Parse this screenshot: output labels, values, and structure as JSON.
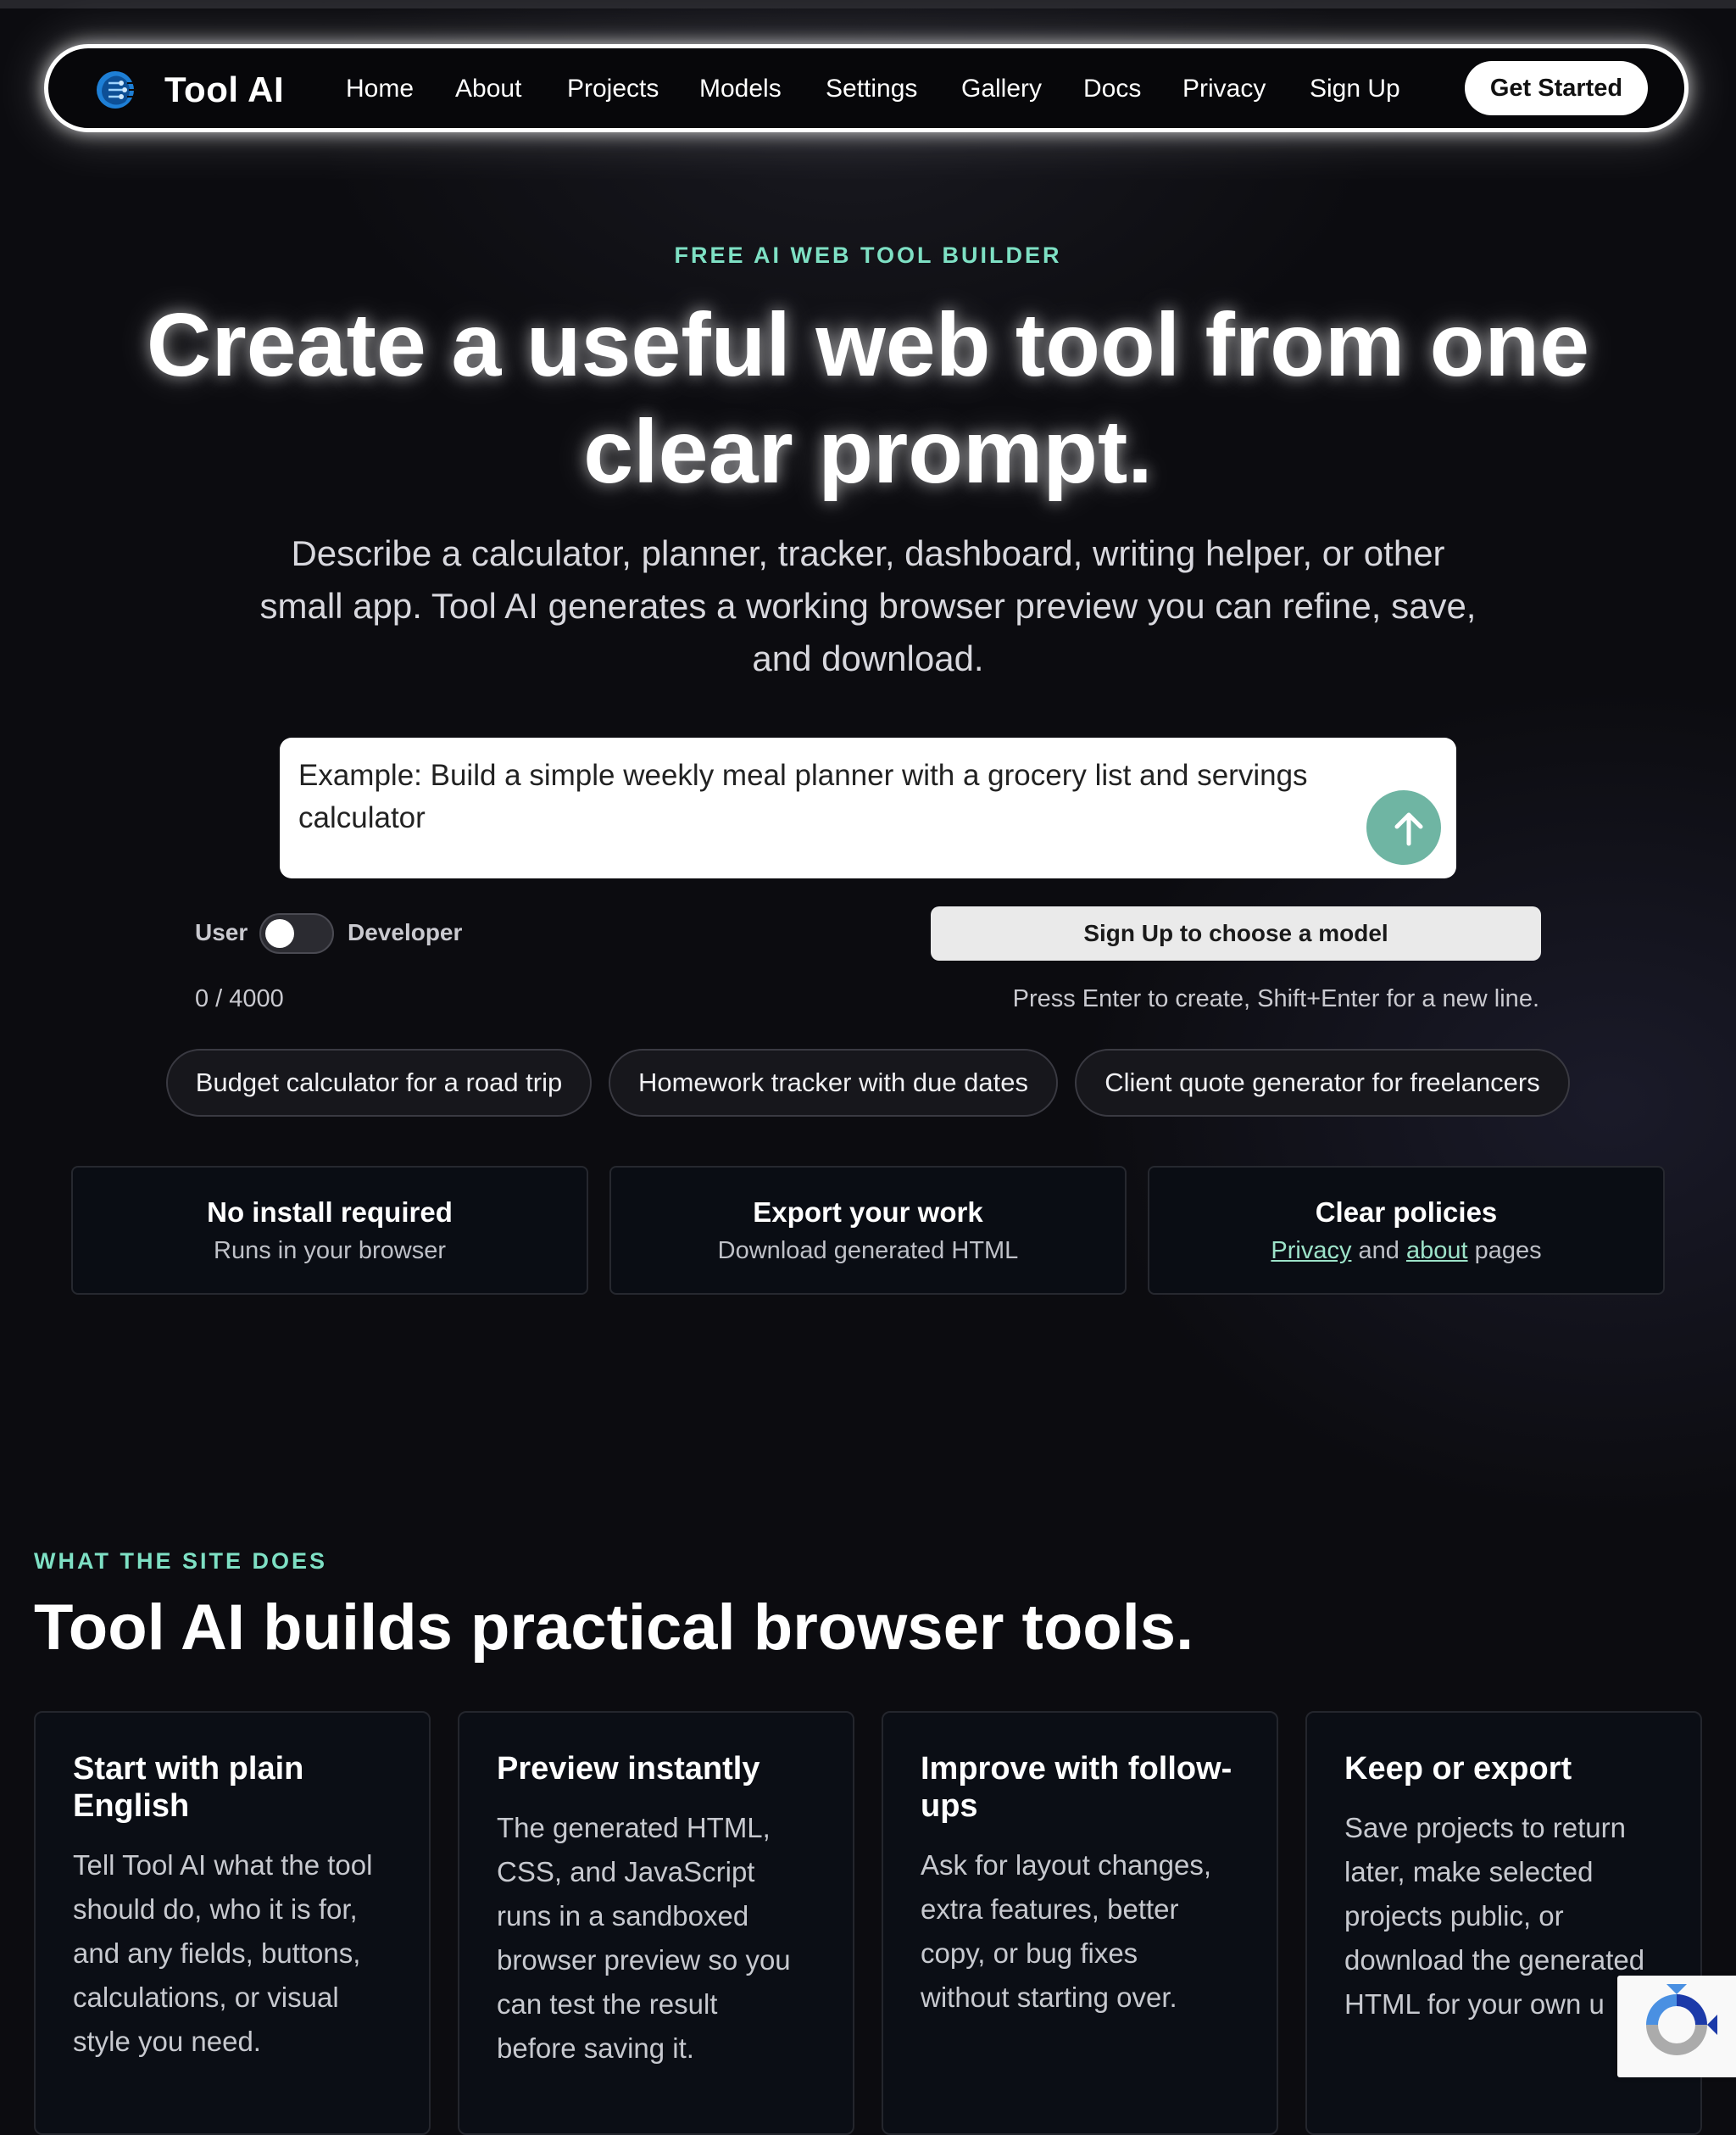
{
  "nav": {
    "brand": "Tool AI",
    "links": [
      "Home",
      "About",
      "Projects",
      "Models",
      "Settings",
      "Gallery",
      "Docs",
      "Privacy",
      "Sign Up"
    ],
    "cta": "Get Started"
  },
  "hero": {
    "eyebrow": "FREE AI WEB TOOL BUILDER",
    "title_line1": "Create a useful web tool from one",
    "title_line2": "clear prompt.",
    "subtitle_line1": "Describe a calculator, planner, tracker, dashboard, writing helper, or other",
    "subtitle_line2": "small app. Tool AI generates a working browser preview you can refine, save,",
    "subtitle_line3": "and download.",
    "prompt_placeholder": "Example: Build a simple weekly meal planner with a grocery list and servings calculator"
  },
  "mode": {
    "user_label": "User",
    "developer_label": "Developer",
    "developer_enabled": false
  },
  "model_button": "Sign Up to choose a model",
  "counter": "0 / 4000",
  "hint": "Press Enter to create, Shift+Enter for a new line.",
  "chips": [
    "Budget calculator for a road trip",
    "Homework tracker with due dates",
    "Client quote generator for freelancers"
  ],
  "features": [
    {
      "title": "No install required",
      "sub": "Runs in your browser"
    },
    {
      "title": "Export your work",
      "sub": "Download generated HTML"
    },
    {
      "title": "Clear policies",
      "sub_link1": "Privacy",
      "sub_and": "and",
      "sub_link2": "about",
      "sub_tail": "pages"
    }
  ],
  "section": {
    "eyebrow": "WHAT THE SITE DOES",
    "title": "Tool AI builds practical browser tools.",
    "cards": [
      {
        "title": [
          "Start with plain",
          "English"
        ],
        "body": [
          "Tell Tool AI what the tool",
          "should do, who it is for,",
          "and any fields, buttons,",
          "calculations, or visual",
          "style you need."
        ]
      },
      {
        "title": [
          "Preview instantly"
        ],
        "body": [
          "The generated HTML,",
          "CSS, and JavaScript",
          "runs in a sandboxed",
          "browser preview so you",
          "can test the result",
          "before saving it."
        ]
      },
      {
        "title": [
          "Improve with follow-",
          "ups"
        ],
        "body": [
          "Ask for layout changes,",
          "extra features, better",
          "copy, or bug fixes",
          "without starting over."
        ]
      },
      {
        "title": [
          "Keep or export"
        ],
        "body": [
          "Save projects to return",
          "later, make selected",
          "projects public, or",
          "download the generated",
          "HTML for your own u"
        ]
      }
    ]
  },
  "colors": {
    "accent": "#7ee0c4",
    "send_button": "#6fb5a3",
    "background": "#0c0c10"
  },
  "icons": {
    "logo": "brain-circuit-icon",
    "send": "arrow-up-icon",
    "recaptcha": "recaptcha-icon"
  }
}
